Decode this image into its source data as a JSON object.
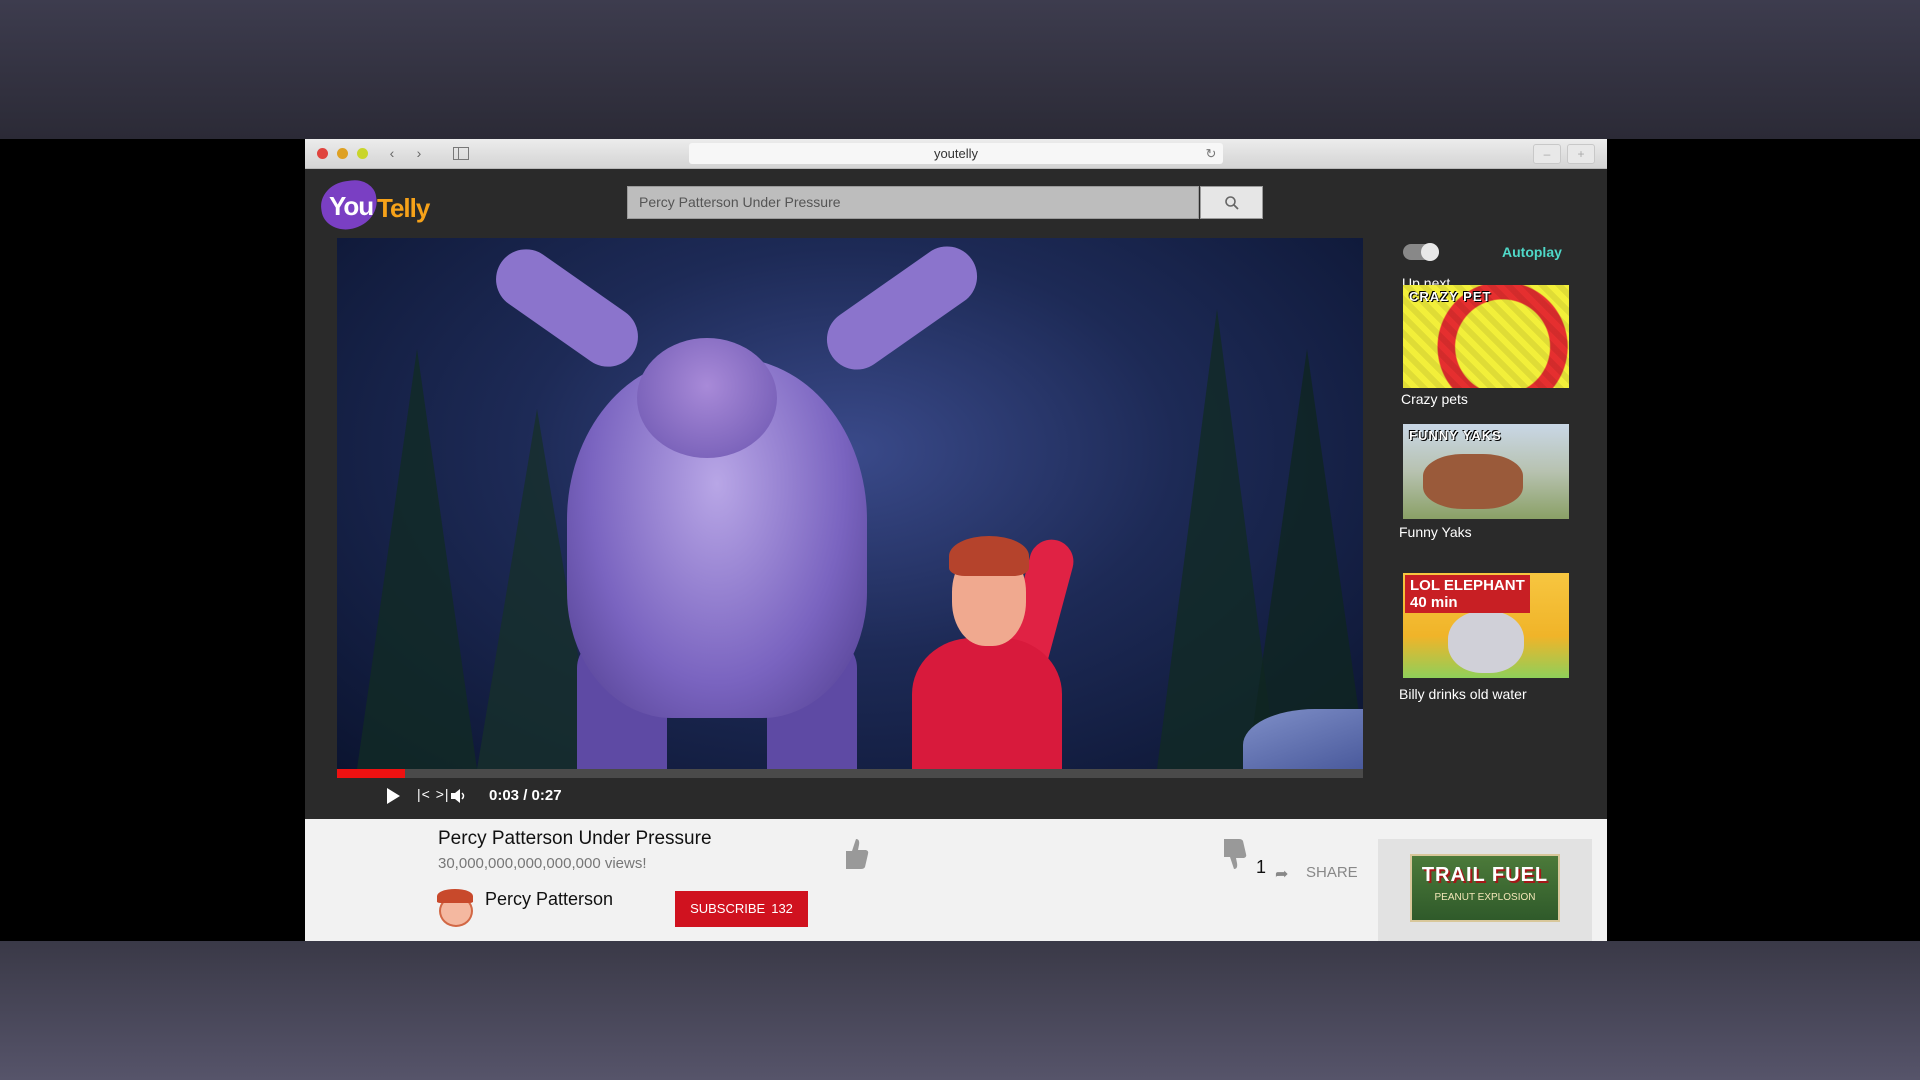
{
  "browser": {
    "address": "youtelly",
    "back_icon": "chevron-left-icon",
    "forward_icon": "chevron-right-icon",
    "sidebar_icon": "sidebar-toggle-icon",
    "reload_icon": "reload-icon"
  },
  "site": {
    "logo_you": "You",
    "logo_telly": "Telly"
  },
  "search": {
    "value": "Percy Patterson Under Pressure",
    "icon": "search-icon"
  },
  "player": {
    "current_time": "0:03",
    "separator": "/",
    "duration": "0:27",
    "progress_fraction": 0.0666,
    "play_icon": "play-icon",
    "skip_icon": "skip-icon",
    "volume_icon": "volume-icon"
  },
  "sidebar": {
    "autoplay_label": "Autoplay",
    "autoplay_on": true,
    "up_next_label": "Up next",
    "items": [
      {
        "title": "Crazy pets",
        "thumb_text": "CRAZY PET"
      },
      {
        "title": "Funny Yaks",
        "thumb_text": "FUNNY YAKS"
      },
      {
        "title": "Billy drinks old water",
        "thumb_text": "LOL ELEPHANT",
        "thumb_subtext": "40 min"
      }
    ]
  },
  "video_info": {
    "title": "Percy Patterson Under Pressure",
    "views": "30,000,000,000,000,000 views!",
    "channel": "Percy Patterson",
    "subscribe_label": "SUBSCRIBE",
    "subscriber_count": "132",
    "dislike_count": "1",
    "share_label": "SHARE"
  },
  "ad": {
    "headline": "TRAIL FUEL",
    "subline": "PEANUT EXPLOSION"
  },
  "colors": {
    "accent_red": "#d0121f",
    "autoplay_teal": "#4fd8c8",
    "logo_purple": "#7a3fc3",
    "logo_orange": "#f6a219"
  }
}
